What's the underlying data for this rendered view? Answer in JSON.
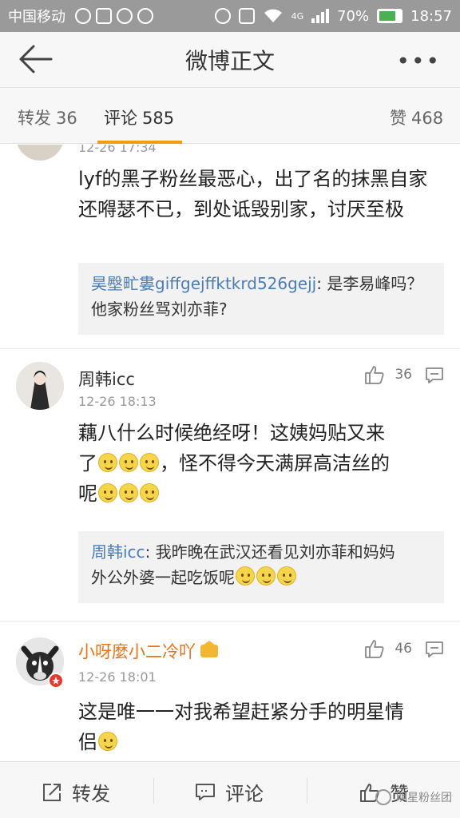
{
  "status_bar": {
    "carrier": "中国移动",
    "network": "4G",
    "battery": "70%",
    "time": "18:57"
  },
  "nav": {
    "title": "微博正文",
    "more": "•••"
  },
  "tabs": {
    "repost": {
      "label": "转发",
      "count": "36"
    },
    "comment": {
      "label": "评论",
      "count": "585"
    },
    "like": {
      "label": "赞",
      "count": "468"
    }
  },
  "comments": [
    {
      "time": "12-26 17:34",
      "text": "lyf的黑子粉丝最恶心，出了名的抹黑自家还嘚瑟不已，到处诋毁别家，讨厌至极",
      "reply": {
        "author": "昊壂甿婁giffgejffktkrd526gejj",
        "text": ": 是李易峰吗？他家粉丝骂刘亦菲?"
      }
    },
    {
      "author": "周韩icc",
      "time": "12-26 18:13",
      "likes": "36",
      "text_line1": "藕八什么时候绝经呀！这姨妈贴又来",
      "text_line2_a": "了",
      "text_line2_b": "，怪不得今天满屏高洁丝的",
      "text_line3": "呢",
      "reply": {
        "author": "周韩icc",
        "text_a": ": 我昨晚在武汉还看见刘亦菲和妈妈",
        "text_b": "外公外婆一起吃饭呢"
      }
    },
    {
      "author": "小呀麼小二冷吖",
      "time": "12-26 18:01",
      "likes": "46",
      "text_line1": "这是唯一一对我希望赶紧分手的明星情",
      "text_line2": "侣"
    }
  ],
  "bottom": {
    "repost": "转发",
    "comment": "评论",
    "like": "赞",
    "watermark": "明星粉丝团"
  },
  "colors": {
    "accent_orange": "#f39c12",
    "vip_name": "#e8731a",
    "link_blue": "#4a7db5"
  }
}
